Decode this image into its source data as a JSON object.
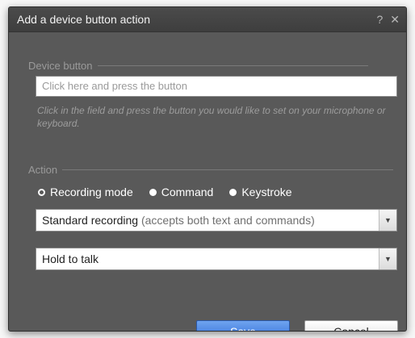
{
  "dialog": {
    "title": "Add a device button action",
    "help_glyph": "?",
    "close_glyph": "✕"
  },
  "device_button": {
    "section_label": "Device button",
    "input_placeholder": "Click here and press the button",
    "hint": "Click in the field and press the button you would like to set on your microphone or keyboard."
  },
  "action": {
    "section_label": "Action",
    "options": [
      {
        "label": "Recording mode",
        "selected": true
      },
      {
        "label": "Command",
        "selected": false
      },
      {
        "label": "Keystroke",
        "selected": false
      }
    ],
    "recording_select": {
      "value": "Standard recording",
      "value_extra": "(accepts both text and commands)"
    },
    "mode_select": {
      "value": "Hold to talk"
    }
  },
  "buttons": {
    "save_label": "Save",
    "cancel_label": "Cancel"
  },
  "colors": {
    "dialog_bg": "#595959",
    "titlebar_bg": "#444444",
    "primary_button": "#3c7ae0"
  },
  "icons": {
    "dropdown": "chevron-down-icon",
    "help": "help-icon",
    "close": "close-icon"
  }
}
